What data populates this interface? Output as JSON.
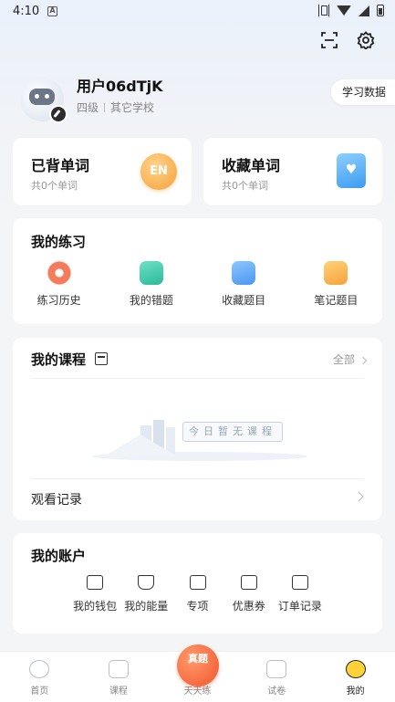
{
  "status_bar": {
    "time": "4:10",
    "notif_letter": "A"
  },
  "header_icons": [
    "scan-icon",
    "gear-icon"
  ],
  "profile": {
    "username": "用户06dTjK",
    "grade": "四级",
    "school": "其它学校",
    "study_data_label": "学习数据"
  },
  "word_cards": [
    {
      "title": "已背单词",
      "count": "共0个单词",
      "badge": "EN"
    },
    {
      "title": "收藏单词",
      "count": "共0个单词"
    }
  ],
  "practice": {
    "title": "我的练习",
    "items": [
      {
        "label": "练习历史",
        "icon": "clock-icon"
      },
      {
        "label": "我的错题",
        "icon": "wrong-book-icon"
      },
      {
        "label": "收藏题目",
        "icon": "favorite-question-icon"
      },
      {
        "label": "笔记题目",
        "icon": "note-icon"
      }
    ]
  },
  "courses": {
    "title": "我的课程",
    "all_label": "全部",
    "empty_text": "今日暂无课程",
    "watch_history": "观看记录"
  },
  "account": {
    "title": "我的账户",
    "items": [
      {
        "label": "我的钱包",
        "icon": "wallet-icon"
      },
      {
        "label": "我的能量",
        "icon": "flask-icon"
      },
      {
        "label": "专项",
        "icon": "basket-icon"
      },
      {
        "label": "优惠券",
        "icon": "coupon-icon"
      },
      {
        "label": "订单记录",
        "icon": "order-icon"
      }
    ]
  },
  "bottom_nav": {
    "items": [
      {
        "label": "首页",
        "icon": "planet-icon",
        "active": false
      },
      {
        "label": "课程",
        "icon": "video-icon",
        "active": false
      },
      {
        "label": "天天练",
        "icon": "daily-practice-icon",
        "active": false
      },
      {
        "label": "试卷",
        "icon": "paper-icon",
        "active": false
      },
      {
        "label": "我的",
        "icon": "profile-icon",
        "active": true
      }
    ],
    "center_badge": "真题"
  },
  "colors": {
    "accent_orange": "#f2542d",
    "badge_gold": "#f5a13a",
    "text_primary": "#111111",
    "text_secondary": "#999999"
  }
}
